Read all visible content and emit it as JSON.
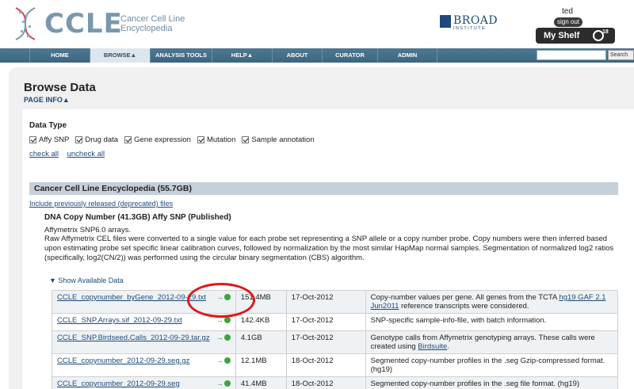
{
  "header": {
    "logo_word": "CCLE",
    "logo_sub_line1": "Cancer Cell Line",
    "logo_sub_line2": "Encyclopedia",
    "broad_word": "BROAD",
    "broad_inst": "INSTITUTE",
    "username": "ted",
    "signout_label": "sign out",
    "myshelf_label": "My Shelf",
    "myshelf_count": "18"
  },
  "nav": {
    "items": [
      "HOME",
      "BROWSE▲",
      "ANALYSIS TOOLS",
      "HELP▲",
      "ABOUT",
      "CURATOR",
      "ADMIN"
    ],
    "active_index": 1,
    "search_value": "",
    "search_button": "Search"
  },
  "page": {
    "title": "Browse Data",
    "page_info": "PAGE INFO▲",
    "data_type_title": "Data Type",
    "data_types": [
      "Affy SNP",
      "Drug data",
      "Gene expression",
      "Mutation",
      "Sample annotation"
    ],
    "check_all": "check all",
    "uncheck_all": "uncheck all",
    "section_title": "Cancer Cell Line Encyclopedia (55.7GB)",
    "deprecated_link": "Include previously released (deprecated) files",
    "dataset_title": "DNA Copy Number  (41.3GB) Affy SNP  (Published)",
    "dataset_arrays": "Affymetrix SNP6.0 arrays.",
    "dataset_desc": "Raw Affymetrix CEL files were converted to a single value for each probe set representing a SNP allele or a copy number probe. Copy numbers were then inferred based upon estimating probe set specific linear calibration curves, followed by normalization by the most similar HapMap normal samples. Segmentation of normalized log2 ratios (specifically, log2(CN/2)) was performed using the circular binary segmentation (CBS) algorithm.",
    "show_data": "▼ Show Available Data"
  },
  "files": [
    {
      "name": "CCLE_copynumber_byGene_2012-09-29.txt",
      "size": "151.4MB",
      "date": "17-Oct-2012",
      "desc_a": "Copy-number values per gene. All genes from the TCTA ",
      "desc_link": "hg19 GAF 2.1 Jun2011",
      "desc_b": " reference transcripts were considered."
    },
    {
      "name": "CCLE_SNP.Arrays.sif_2012-09-29.txt",
      "size": "142.4KB",
      "date": "17-Oct-2012",
      "desc_a": "SNP-specific sample-info-file, with batch information.",
      "desc_link": "",
      "desc_b": ""
    },
    {
      "name": "CCLE_SNP.Birdseed.Calls_2012-09-29.tar.gz",
      "size": "4.1GB",
      "date": "17-Oct-2012",
      "desc_a": "Genotype calls from Affymetrix genotyping arrays. These calls were created using ",
      "desc_link": "Birdsuite",
      "desc_b": "."
    },
    {
      "name": "CCLE_copynumber_2012-09-29.seg.gz",
      "size": "12.1MB",
      "date": "18-Oct-2012",
      "desc_a": "Segmented copy-number profiles in the .seg Gzip-compressed format. (hg19)",
      "desc_link": "",
      "desc_b": ""
    },
    {
      "name": "CCLE_copynumber_2012-09-29.seg",
      "size": "41.4MB",
      "date": "18-Oct-2012",
      "desc_a": "Segmented copy-number profiles in the .seg file format. (hg19)",
      "desc_link": "",
      "desc_b": ""
    }
  ],
  "add_icon_text": "→",
  "colors": {
    "nav": "#3d657f",
    "link": "#1f4a7a",
    "annotation": "#e0181a"
  }
}
